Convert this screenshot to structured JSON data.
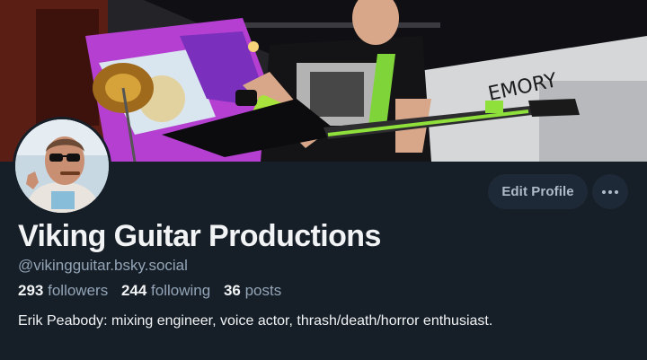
{
  "profile": {
    "display_name": "Viking Guitar Productions",
    "handle": "@vikingguitar.bsky.social",
    "bio": "Erik Peabody: mixing engineer, voice actor, thrash/death/horror enthusiast."
  },
  "stats": {
    "followers_count": "293",
    "followers_label": "followers",
    "following_count": "244",
    "following_label": "following",
    "posts_count": "36",
    "posts_label": "posts"
  },
  "actions": {
    "edit_label": "Edit Profile",
    "more_icon": "ellipsis-icon"
  },
  "banner": {
    "wall_text": "EMORY"
  },
  "colors": {
    "background": "#161e27",
    "button_bg": "#1e2937",
    "text_primary": "#f1f3f5",
    "text_secondary": "#93a5b7",
    "accent_green": "#8fe03a"
  }
}
